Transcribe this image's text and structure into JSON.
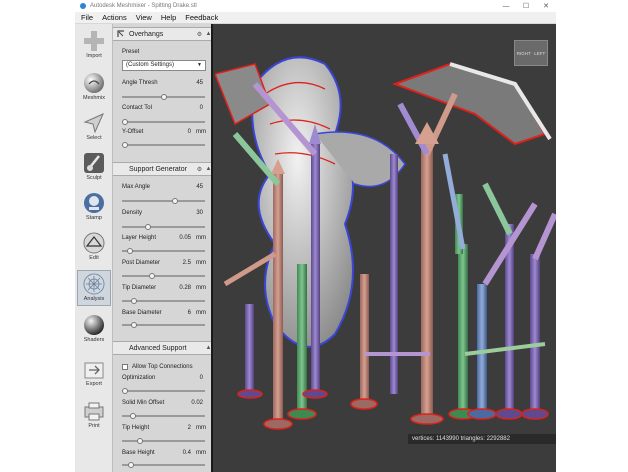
{
  "window": {
    "title": "Autodesk Meshmixer - Spitting Drake.stl",
    "minimize": "—",
    "maximize": "☐",
    "close": "✕"
  },
  "menu": [
    "File",
    "Actions",
    "View",
    "Help",
    "Feedback"
  ],
  "tools": [
    {
      "label": "Import",
      "icon": "plus-icon"
    },
    {
      "label": "Meshmix",
      "icon": "sphere-icon"
    },
    {
      "label": "Select",
      "icon": "cursor-icon"
    },
    {
      "label": "Sculpt",
      "icon": "brush-icon"
    },
    {
      "label": "Stamp",
      "icon": "stamp-icon"
    },
    {
      "label": "Edit",
      "icon": "edit-icon"
    },
    {
      "label": "Analysis",
      "icon": "analysis-icon"
    },
    {
      "label": "Shaders",
      "icon": "shader-ball-icon"
    },
    {
      "label": "Export",
      "icon": "export-icon"
    },
    {
      "label": "Print",
      "icon": "printer-icon"
    }
  ],
  "overhangs": {
    "title": "Overhangs",
    "preset_label": "Preset",
    "preset_value": "(Custom Settings)",
    "angle_thresh": {
      "label": "Angle Thresh",
      "value": "45",
      "fraction": 0.5
    },
    "contact_tol": {
      "label": "Contact Tol",
      "value": "0",
      "fraction": 0.0
    },
    "y_offset": {
      "label": "Y-Offset",
      "value": "0",
      "unit": "mm",
      "fraction": 0.0
    }
  },
  "support_generator": {
    "title": "Support Generator",
    "max_angle": {
      "label": "Max Angle",
      "value": "45",
      "fraction": 0.65
    },
    "density": {
      "label": "Density",
      "value": "30",
      "fraction": 0.3
    },
    "layer_height": {
      "label": "Layer Height",
      "value": "0.05",
      "unit": "mm",
      "fraction": 0.06
    },
    "post_diameter": {
      "label": "Post Diameter",
      "value": "2.5",
      "unit": "mm",
      "fraction": 0.35
    },
    "tip_diameter": {
      "label": "Tip Diameter",
      "value": "0.28",
      "unit": "mm",
      "fraction": 0.12
    },
    "base_diameter": {
      "label": "Base Diameter",
      "value": "6",
      "unit": "mm",
      "fraction": 0.12
    }
  },
  "advanced_support": {
    "title": "Advanced Support",
    "allow_top": "Allow Top Connections",
    "optimization": {
      "label": "Optimization",
      "value": "0",
      "fraction": 0.0
    },
    "solid_min_offset": {
      "label": "Solid Min Offset",
      "value": "0.02",
      "fraction": 0.1
    },
    "tip_height": {
      "label": "Tip Height",
      "value": "2",
      "unit": "mm",
      "fraction": 0.2
    },
    "base_height": {
      "label": "Base Height",
      "value": "0.4",
      "unit": "mm",
      "fraction": 0.08
    }
  },
  "viewcube": {
    "right": "RIGHT",
    "left": "LEFT"
  },
  "status": "vertices: 1143990 triangles: 2292882",
  "colors": {
    "accent": "#2b84d6",
    "viewport_bg": "#3c3c3c",
    "overhang": "#e0201a"
  }
}
